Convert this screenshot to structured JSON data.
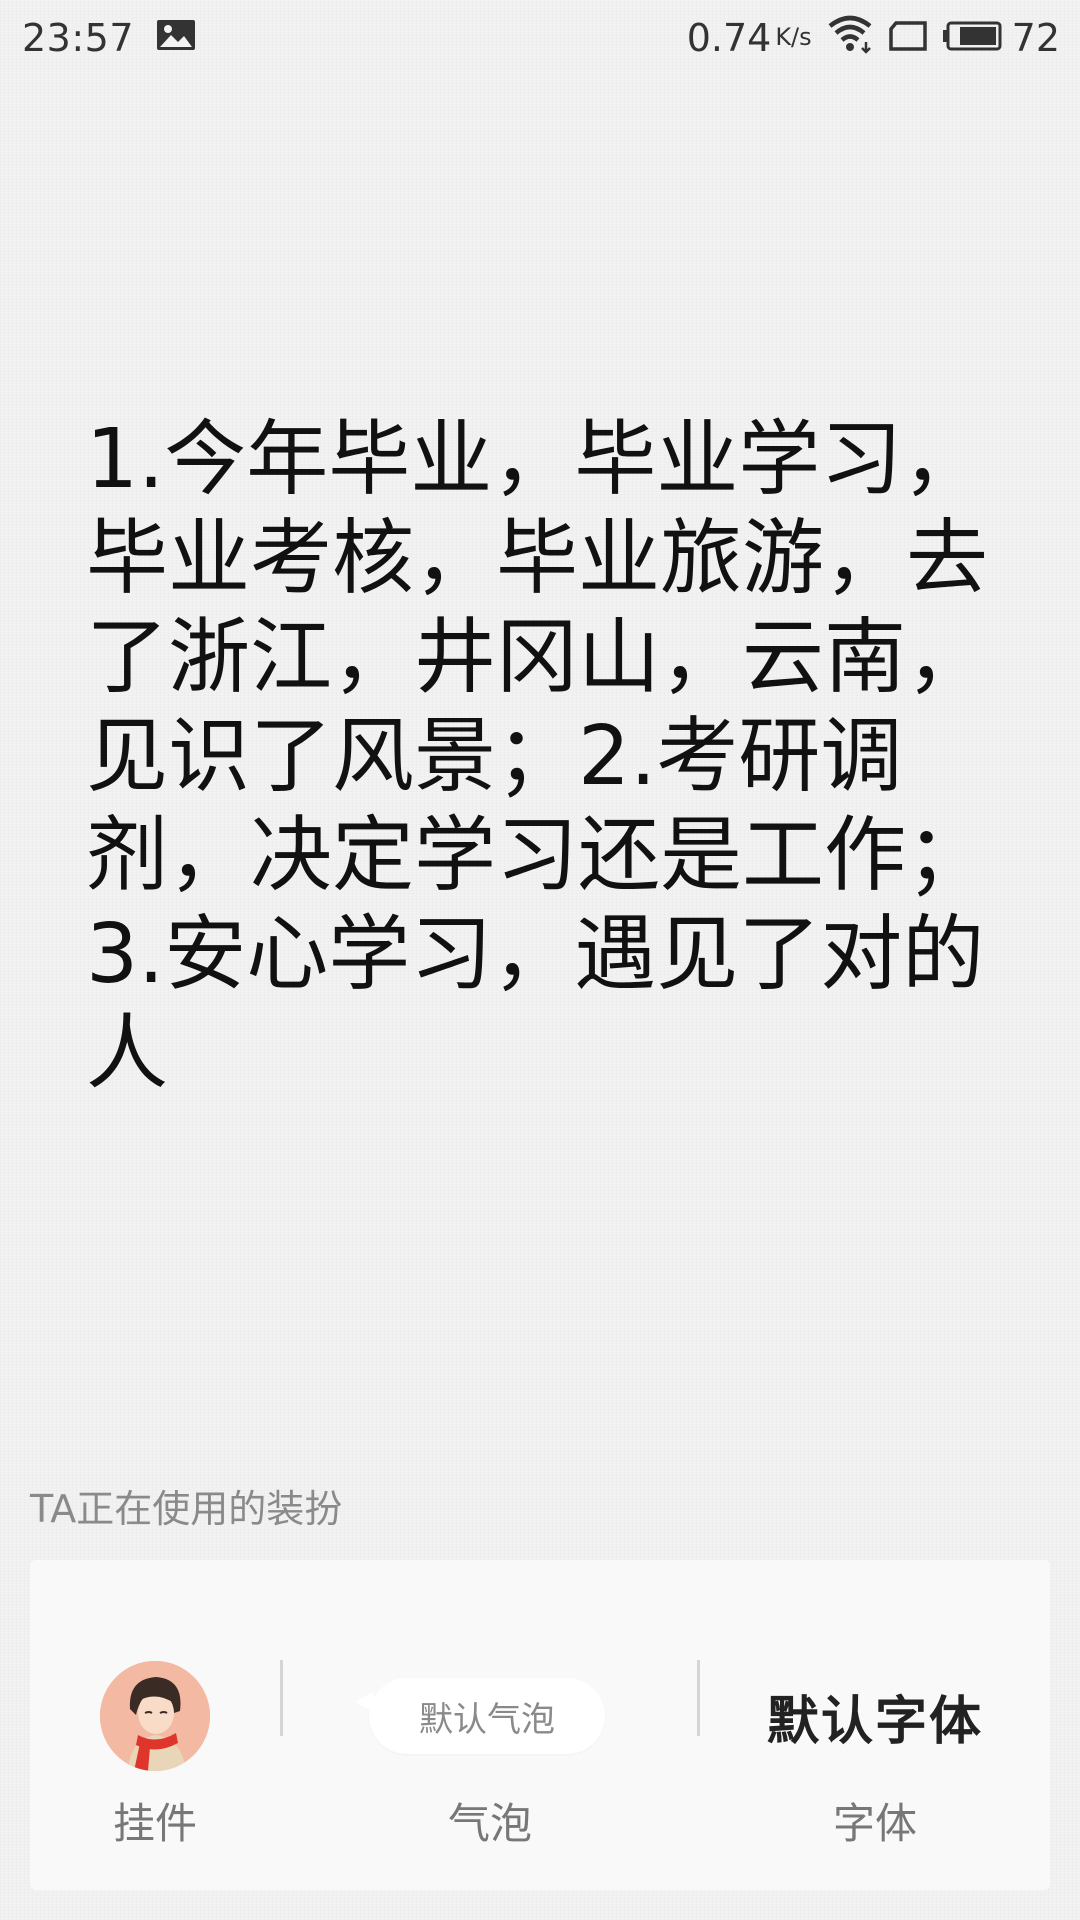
{
  "status_bar": {
    "time": "23:57",
    "net_speed": "0.74",
    "net_unit": "K/s",
    "battery_level": "72",
    "icons": [
      "gallery-icon",
      "wifi-icon",
      "sim-icon",
      "battery-icon"
    ]
  },
  "message": {
    "text": "1.今年毕业，毕业学习，毕业考核，毕业旅游，去了浙江，井冈山，云南，见识了风景；2.考研调剂，决定学习还是工作；3.安心学习，遇见了对的人"
  },
  "decor": {
    "section_title": "TA正在使用的装扮",
    "items": [
      {
        "id": "pendant",
        "caption": "挂件",
        "icon": "avatar-pendant"
      },
      {
        "id": "bubble",
        "caption": "气泡",
        "preview_text": "默认气泡"
      },
      {
        "id": "font",
        "caption": "字体",
        "preview_text": "默认字体"
      }
    ]
  },
  "colors": {
    "background": "#f2f2f2",
    "card": "#f9f9f9",
    "caption": "#777777",
    "section_title": "#8a8a8a",
    "scarf_red": "#e0352b",
    "avatar_bg": "#f2b29a"
  }
}
